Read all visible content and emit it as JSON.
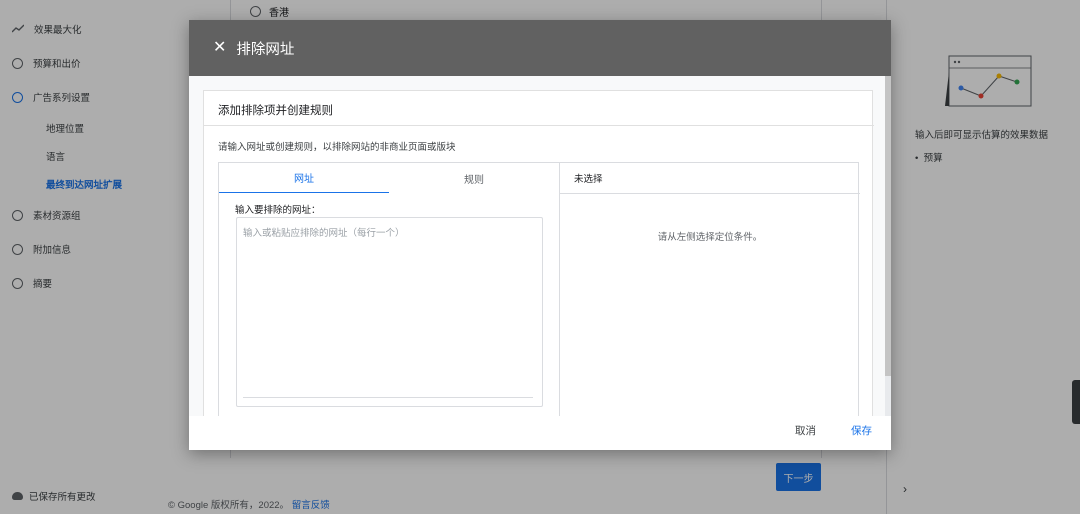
{
  "sidebar": {
    "items": [
      {
        "label": "效果最大化",
        "icon": "trend-icon"
      },
      {
        "label": "预算和出价",
        "icon": "radio-icon"
      },
      {
        "label": "广告系列设置",
        "icon": "radio-icon"
      },
      {
        "label": "素材资源组",
        "icon": "radio-icon"
      },
      {
        "label": "附加信息",
        "icon": "radio-icon"
      },
      {
        "label": "摘要",
        "icon": "radio-icon"
      }
    ],
    "sub_items": [
      {
        "label": "地理位置"
      },
      {
        "label": "语言"
      },
      {
        "label": "最终到达网址扩展"
      }
    ],
    "saved_status": "已保存所有更改"
  },
  "background": {
    "hk_option": "香港",
    "footer_text": "© Google 版权所有，2022。",
    "footer_link": "留言反馈",
    "next_button": "下一步"
  },
  "right_panel": {
    "hint": "输入后即可显示估算的效果数据",
    "bullet": "预算"
  },
  "modal": {
    "title": "排除网址",
    "card_title": "添加排除项并创建规则",
    "description": "请输入网址或创建规则，以排除网站的非商业页面或版块",
    "tabs": [
      {
        "label": "网址"
      },
      {
        "label": "规则"
      }
    ],
    "url_label": "输入要排除的网址：",
    "url_placeholder": "输入或粘贴应排除的网址（每行一个）",
    "right_header": "未选择",
    "right_empty": "请从左侧选择定位条件。",
    "cancel": "取消",
    "save": "保存"
  },
  "colors": {
    "accent": "#1a73e8",
    "header": "#616161"
  }
}
